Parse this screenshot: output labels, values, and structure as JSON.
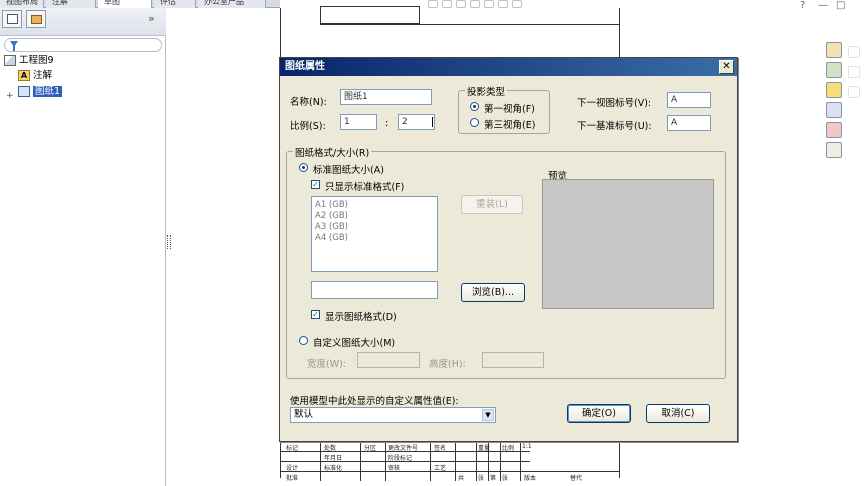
{
  "top_tabs": [
    "视图布局",
    "注解",
    "草图",
    "评估",
    "办公室产品"
  ],
  "feature_tree": {
    "root": "工程图9",
    "items": [
      "注解",
      "图纸1"
    ],
    "expander": "+"
  },
  "panel_chevron": "»",
  "window_controls": [
    "?",
    "—",
    "□"
  ],
  "title_block": {
    "labels": [
      "标记",
      "处数",
      "分区",
      "更改文件号",
      "签名",
      "年月日",
      "设计",
      "标准化",
      "阶段标记",
      "重量",
      "比例",
      "1:1",
      "审核",
      "工艺",
      "批准",
      "共",
      "张",
      "第",
      "张",
      "版本",
      "替代"
    ]
  },
  "dialog": {
    "title": "图纸属性",
    "close_glyph": "✕",
    "name_label": "名称(N):",
    "name_value": "图纸1",
    "scale_label": "比例(S):",
    "scale_numerator": "1",
    "scale_separator": ":",
    "scale_denominator": "2",
    "projection": {
      "legend": "投影类型",
      "first_angle": "第一视角(F)",
      "third_angle": "第三视角(E)",
      "selected": "first"
    },
    "next_view_label": "下一视图标号(V):",
    "next_view_value": "A",
    "next_datum_label": "下一基准标号(U):",
    "next_datum_value": "A",
    "format": {
      "legend": "图纸格式/大小(R)",
      "standard_size": "标准图纸大小(A)",
      "show_standard_only": "只显示标准格式(F)",
      "sizes": [
        "A1 (GB)",
        "A2 (GB)",
        "A3 (GB)",
        "A4 (GB)"
      ],
      "reload_button": "重装(L)",
      "path_value": "",
      "browse_button": "浏览(B)...",
      "display_format": "显示图纸格式(D)",
      "custom_size": "自定义图纸大小(M)",
      "width_label": "宽度(W):",
      "height_label": "高度(H):",
      "preview_label": "预览"
    },
    "custom_prop_label": "使用模型中此处显示的自定义属性值(E):",
    "custom_prop_value": "默认",
    "ok_button": "确定(O)",
    "cancel_button": "取消(C)"
  }
}
